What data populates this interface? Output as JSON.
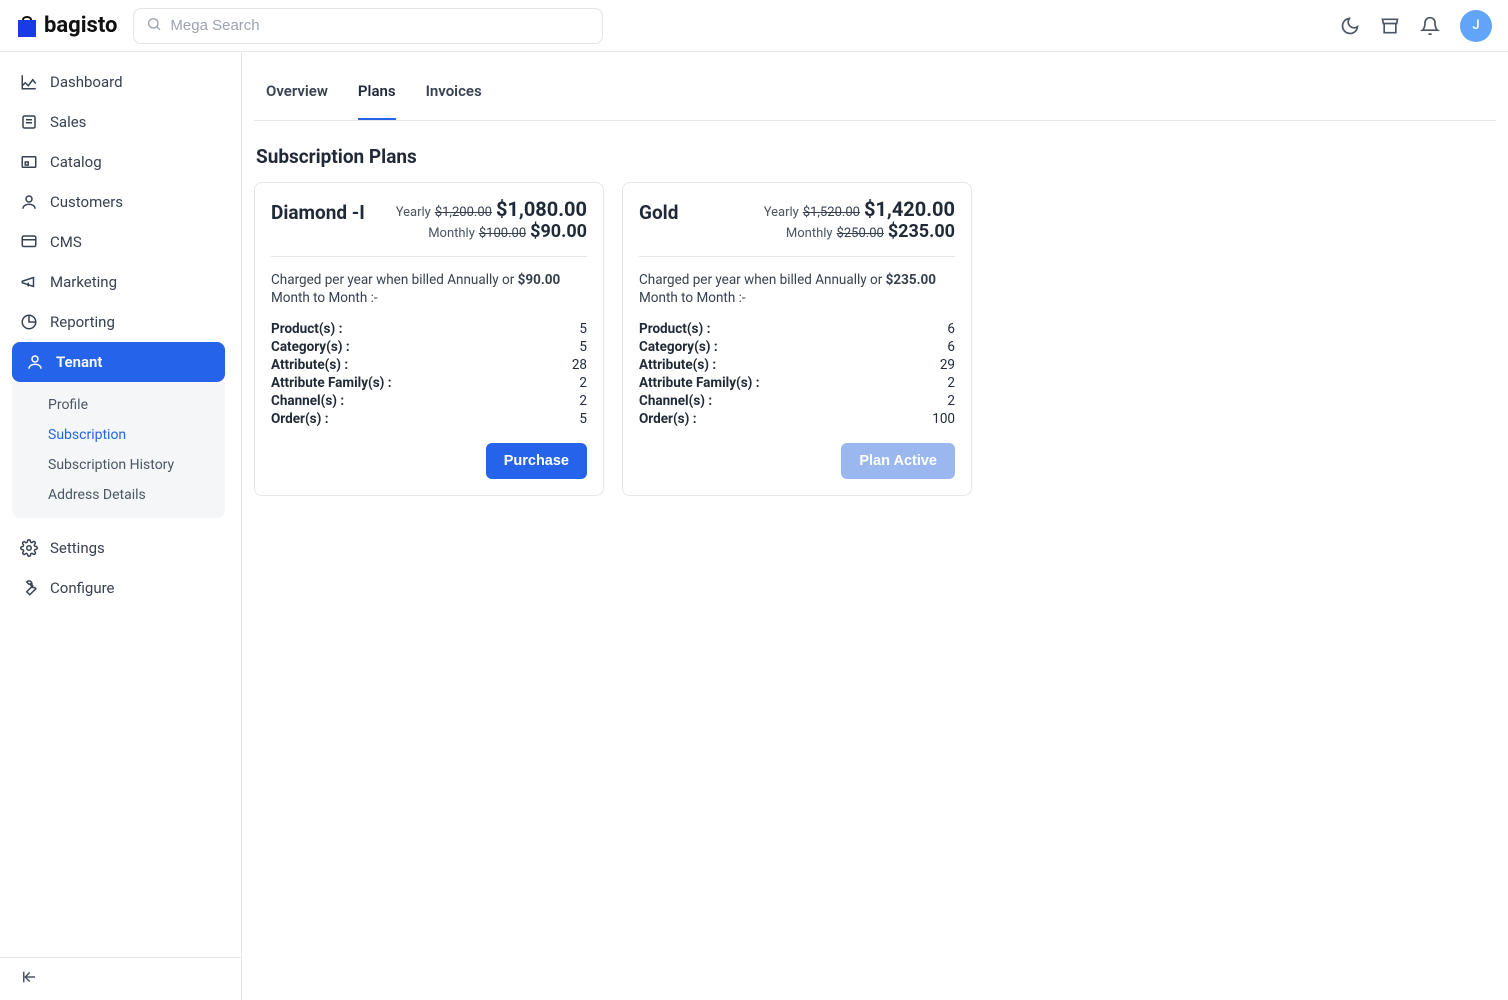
{
  "brand": "bagisto",
  "search": {
    "placeholder": "Mega Search"
  },
  "avatar_letter": "J",
  "sidebar": {
    "items": [
      {
        "label": "Dashboard"
      },
      {
        "label": "Sales"
      },
      {
        "label": "Catalog"
      },
      {
        "label": "Customers"
      },
      {
        "label": "CMS"
      },
      {
        "label": "Marketing"
      },
      {
        "label": "Reporting"
      },
      {
        "label": "Tenant"
      },
      {
        "label": "Settings"
      },
      {
        "label": "Configure"
      }
    ],
    "tenant_sub": [
      {
        "label": "Profile"
      },
      {
        "label": "Subscription"
      },
      {
        "label": "Subscription History"
      },
      {
        "label": "Address Details"
      }
    ]
  },
  "tabs": {
    "overview": "Overview",
    "plans": "Plans",
    "invoices": "Invoices"
  },
  "page_title": "Subscription Plans",
  "stat_labels": {
    "product": "Product(s) :",
    "category": "Category(s) :",
    "attribute": "Attribute(s) :",
    "attribute_family": "Attribute Family(s) :",
    "channel": "Channel(s) :",
    "order": "Order(s) :"
  },
  "desc_parts": {
    "prefix": "Charged per year when billed Annually or ",
    "suffix": " Month to Month :-"
  },
  "price_period": {
    "yearly": "Yearly",
    "monthly": "Monthly"
  },
  "plans": [
    {
      "name": "Diamond -I",
      "yearly_strike": "$1,200.00",
      "yearly_price": "$1,080.00",
      "monthly_strike": "$100.00",
      "monthly_price": "$90.00",
      "desc_bold": "$90.00",
      "stats": {
        "product": "5",
        "category": "5",
        "attribute": "28",
        "attribute_family": "2",
        "channel": "2",
        "order": "5"
      },
      "button": "Purchase",
      "button_state": "primary"
    },
    {
      "name": "Gold",
      "yearly_strike": "$1,520.00",
      "yearly_price": "$1,420.00",
      "monthly_strike": "$250.00",
      "monthly_price": "$235.00",
      "desc_bold": "$235.00",
      "stats": {
        "product": "6",
        "category": "6",
        "attribute": "29",
        "attribute_family": "2",
        "channel": "2",
        "order": "100"
      },
      "button": "Plan Active",
      "button_state": "muted"
    }
  ]
}
